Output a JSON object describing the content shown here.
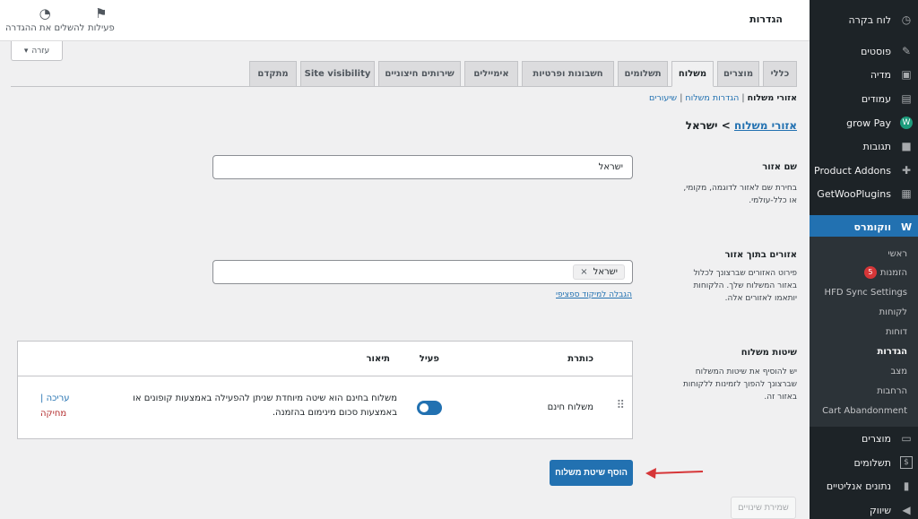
{
  "sidebar": {
    "items": [
      {
        "label": "לוח בקרה",
        "icon": "dashboard-icon"
      },
      {
        "label": "פוסטים",
        "icon": "pin-icon"
      },
      {
        "label": "מדיה",
        "icon": "media-icon"
      },
      {
        "label": "עמודים",
        "icon": "pages-icon"
      },
      {
        "label": "grow Pay",
        "icon": "growpay-icon"
      },
      {
        "label": "תגובות",
        "icon": "comments-icon"
      },
      {
        "label": "Product Addons",
        "icon": "addons-icon"
      },
      {
        "label": "GetWooPlugins",
        "icon": "plugins-icon"
      },
      {
        "label": "ווקומרס",
        "icon": "woocommerce-icon"
      }
    ],
    "sub": [
      "ראשי",
      "הזמנות",
      "HFD Sync Settings",
      "לקוחות",
      "דוחות",
      "הגדרות",
      "מצב",
      "הרחבות",
      "Cart Abandonment"
    ],
    "orders_badge": "5",
    "bottom": [
      {
        "label": "מוצרים",
        "icon": "products-icon"
      },
      {
        "label": "תשלומים",
        "icon": "payments-icon"
      },
      {
        "label": "נתונים אנליטיים",
        "icon": "analytics-icon"
      },
      {
        "label": "שיווק",
        "icon": "marketing-icon"
      }
    ]
  },
  "header": {
    "title": "הגדרות",
    "activity": "פעילות",
    "finish_setup": "להשלים את ההגדרה",
    "help": "עזרה"
  },
  "tabs": [
    "כללי",
    "מוצרים",
    "משלוח",
    "תשלומים",
    "חשבונות ופרטיות",
    "אימיילים",
    "שירותים חיצוניים",
    "Site visibility",
    "מתקדם"
  ],
  "active_tab": "משלוח",
  "subnav": {
    "current": "אזורי משלוח",
    "options": "הגדרות משלוח",
    "classes": "שיעורים"
  },
  "breadcrumb": {
    "link": "אזורי משלוח",
    "sep": ">",
    "current": "ישראל"
  },
  "zone_name": {
    "label": "שם אזור",
    "desc": "בחירת שם לאזור לדוגמה, מקומי, או כלל-עולמי.",
    "value": "ישראל"
  },
  "zone_regions": {
    "label": "אזורים בתוך אזור",
    "desc": "פירוט האזורים שברצונך לכלול באזור המשלוח שלך. הלקוחות יותאמו לאזורים אלה.",
    "chip": "ישראל",
    "limit_link": "הגבלה למיקוד ספציפי"
  },
  "methods": {
    "label": "שיטות משלוח",
    "desc": "יש להוסיף את שיטות המשלוח שברצונך להפוך לזמינות ללקוחות באזור זה.",
    "headers": {
      "title": "כותרת",
      "enabled": "פעיל",
      "description": "תיאור"
    },
    "rows": [
      {
        "title": "משלוח חינם",
        "description": "משלוח בחינם הוא שיטה מיוחדת שניתן להפעילה באמצעות קופונים או באמצעות סכום מינימום בהזמנה.",
        "edit": "עריכה",
        "sep": "|",
        "delete": "מחיקה",
        "enabled": true
      }
    ]
  },
  "add_button": "הוסף שיטת משלוח",
  "save_button": "שמירת שינויים",
  "colors": {
    "accent": "#2271b1",
    "sidebar": "#1d2327",
    "arrow": "#d63638"
  }
}
